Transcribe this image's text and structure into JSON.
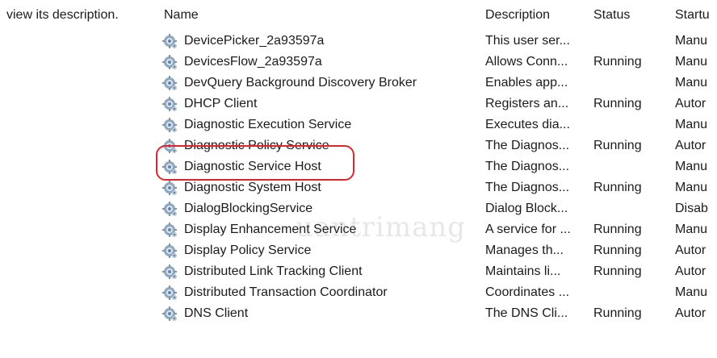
{
  "left_pane": {
    "description_hint": "view its description."
  },
  "columns": {
    "name": "Name",
    "description": "Description",
    "status": "Status",
    "startup": "Startu"
  },
  "rows": [
    {
      "name": "DevicePicker_2a93597a",
      "description": "This user ser...",
      "status": "",
      "startup": "Manu"
    },
    {
      "name": "DevicesFlow_2a93597a",
      "description": "Allows Conn...",
      "status": "Running",
      "startup": "Manu"
    },
    {
      "name": "DevQuery Background Discovery Broker",
      "description": "Enables app...",
      "status": "",
      "startup": "Manu"
    },
    {
      "name": "DHCP Client",
      "description": "Registers an...",
      "status": "Running",
      "startup": "Autor"
    },
    {
      "name": "Diagnostic Execution Service",
      "description": "Executes dia...",
      "status": "",
      "startup": "Manu"
    },
    {
      "name": "Diagnostic Policy Service",
      "description": "The Diagnos...",
      "status": "Running",
      "startup": "Autor"
    },
    {
      "name": "Diagnostic Service Host",
      "description": "The Diagnos...",
      "status": "",
      "startup": "Manu"
    },
    {
      "name": "Diagnostic System Host",
      "description": "The Diagnos...",
      "status": "Running",
      "startup": "Manu"
    },
    {
      "name": "DialogBlockingService",
      "description": "Dialog Block...",
      "status": "",
      "startup": "Disab"
    },
    {
      "name": "Display Enhancement Service",
      "description": "A service for ...",
      "status": "Running",
      "startup": "Manu"
    },
    {
      "name": "Display Policy Service",
      "description": "Manages th...",
      "status": "Running",
      "startup": "Autor"
    },
    {
      "name": "Distributed Link Tracking Client",
      "description": "Maintains li...",
      "status": "Running",
      "startup": "Autor"
    },
    {
      "name": "Distributed Transaction Coordinator",
      "description": "Coordinates ...",
      "status": "",
      "startup": "Manu"
    },
    {
      "name": "DNS Client",
      "description": "The DNS Cli...",
      "status": "Running",
      "startup": "Autor"
    }
  ],
  "icons": {
    "service": "gear-service-icon"
  },
  "highlight_color": "#e0242b",
  "watermark": "uantrimang"
}
